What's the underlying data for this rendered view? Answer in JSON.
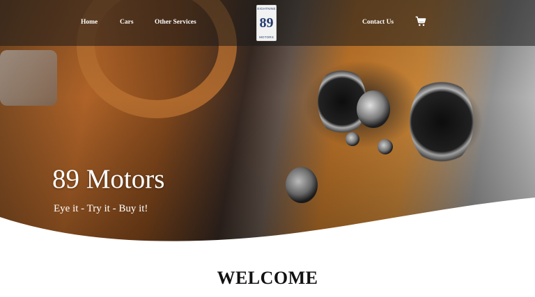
{
  "nav": {
    "home": "Home",
    "cars": "Cars",
    "other_services": "Other Services",
    "contact": "Contact Us"
  },
  "logo": {
    "top_text": "EIGHTNINE",
    "number": "89",
    "bottom_text": "MOTORS",
    "brand_color": "#233a6e"
  },
  "cart_icon": "shopping-cart-icon",
  "hero": {
    "title": "89 Motors",
    "tagline": "Eye it - Try it - Buy it!"
  },
  "welcome": {
    "heading": "WELCOME"
  },
  "colors": {
    "leather_orange": "#c4782a",
    "nav_overlay": "#191919",
    "text_light": "#ffffff",
    "text_dark": "#111111"
  }
}
